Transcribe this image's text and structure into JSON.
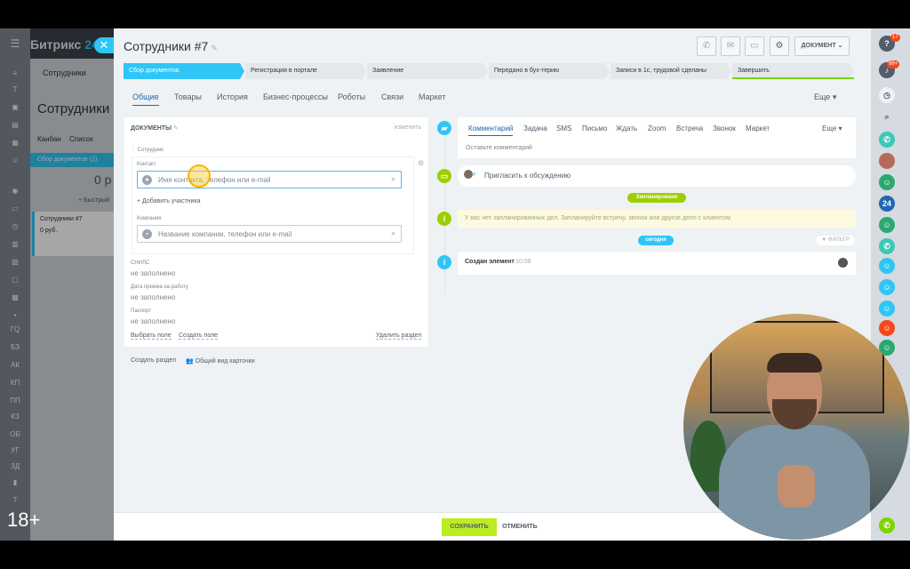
{
  "bg": {
    "logo": "Битрикс",
    "logo_accent": "24",
    "tab": "Сотрудники",
    "title": "Сотрудники",
    "view_kanban": "Канбан",
    "view_list": "Список",
    "column": "Сбор документов",
    "column_count": "(1)",
    "sum": "0 р",
    "quick": "+ Быстрый",
    "card_title": "Сотрудники #7",
    "card_sum": "0 руб."
  },
  "leftnav": [
    "Т",
    "ГQ",
    "БЗ",
    "АК",
    "КП",
    "ПП",
    "КЗ",
    "ОБ",
    "УГ",
    "ЗД",
    "Т"
  ],
  "slider": {
    "title": "Сотрудники #7",
    "document_button": "ДОКУМЕНТ"
  },
  "stages": [
    "Сбор документов",
    "Регистрация в портале",
    "Заявление",
    "Передано в бух-терию",
    "Записи в 1с, трудовой сделаны",
    "Завершить"
  ],
  "tabs": [
    "Общие",
    "Товары",
    "История",
    "Бизнес-процессы",
    "Роботы",
    "Связи",
    "Маркет"
  ],
  "tabs_more": "Еще",
  "card": {
    "heading": "ДОКУМЕНТЫ",
    "change": "изменить",
    "employee_label": "Сотрудник",
    "contact_label": "Контакт",
    "contact_placeholder": "Имя контакта, телефон или e-mail",
    "add_participant": "+ Добавить участника",
    "company_label": "Компания",
    "company_placeholder": "Название компании, телефон или e-mail",
    "fields": [
      {
        "label": "СНИЛС",
        "value": "не заполнено"
      },
      {
        "label": "Дата приема на работу",
        "value": "не заполнено"
      },
      {
        "label": "Паспорт",
        "value": "не заполнено"
      }
    ],
    "select_field": "Выбрать поле",
    "create_field": "Создать поле",
    "delete_section": "Удалить раздел"
  },
  "below_card": {
    "create_section": "Создать раздел",
    "common_view": "Общий вид карточки"
  },
  "editor": {
    "tabs": [
      "Комментарий",
      "Задача",
      "SMS",
      "Письмо",
      "Ждать",
      "Zoom",
      "Встреча",
      "Звонок",
      "Маркет"
    ],
    "more": "Еще",
    "placeholder": "Оставьте комментарий"
  },
  "invite": "Пригласить к обсуждению",
  "planned_pill": "Запланировано",
  "planned_text": "У вас нет запланированных дел. Запланируйте встречу, звонок или другое дело с клиентом",
  "today_pill": "сегодня",
  "filter": "ФИЛЬТР",
  "created": {
    "text": "Создан элемент",
    "time": "10:08"
  },
  "footer": {
    "save": "СОХРАНИТЬ",
    "cancel": "ОТМЕНИТЬ"
  },
  "overlay_rating": "18+",
  "rightbar": {
    "badge_help": "17",
    "badge_notify": "99+",
    "badge_b": "24"
  },
  "colors": {
    "accent": "#2fc6f6",
    "save": "#bbed21",
    "planned": "#7bd500",
    "link": "#2067b0"
  }
}
